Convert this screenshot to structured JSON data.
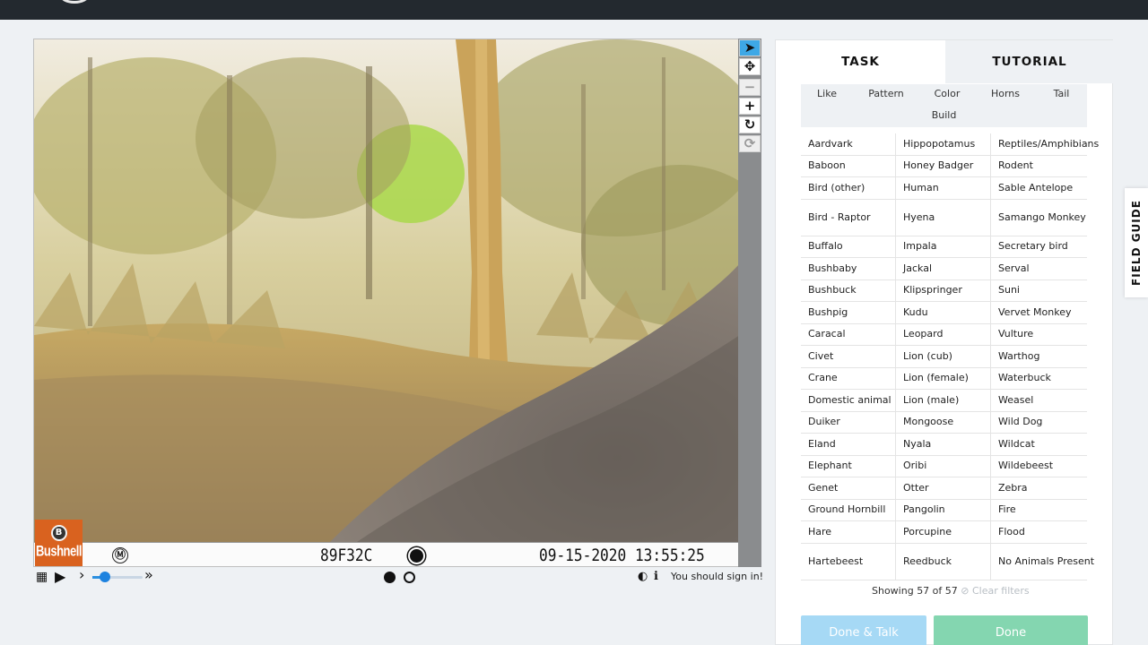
{
  "camera": {
    "brand": "Bushnell",
    "moon_symbol": "Ⓜ",
    "camera_id": "89F32C",
    "timestamp": "09-15-2020 13:55:25"
  },
  "toolbar": {
    "items": [
      {
        "name": "pointer",
        "icon": "pointer-icon",
        "glyph": "➤",
        "state": "active"
      },
      {
        "name": "move",
        "icon": "move-icon",
        "glyph": "✥",
        "state": "normal"
      },
      {
        "name": "zoom-out",
        "icon": "minus-icon",
        "glyph": "−",
        "state": "disabled"
      },
      {
        "name": "zoom-in",
        "icon": "plus-icon",
        "glyph": "+",
        "state": "normal"
      },
      {
        "name": "rotate",
        "icon": "rotate-icon",
        "glyph": "↻",
        "state": "normal"
      },
      {
        "name": "reset",
        "icon": "reset-icon",
        "glyph": "⟳",
        "state": "disabled"
      }
    ]
  },
  "controls": {
    "grid_glyph": "▦",
    "play_glyph": "▶",
    "slow_glyph": "›",
    "fast_glyph": "»",
    "contrast_glyph": "◐",
    "info_glyph": "ℹ",
    "signin_text": "You should sign in!",
    "frames": {
      "current": 1,
      "total": 2
    }
  },
  "panel": {
    "tabs": [
      "TASK",
      "TUTORIAL"
    ],
    "active_tab": "TASK",
    "filters": [
      "Like",
      "Pattern",
      "Color",
      "Horns",
      "Tail",
      "Build"
    ],
    "choices": [
      [
        "Aardvark",
        "Hippopotamus",
        "Reptiles/Amphibians"
      ],
      [
        "Baboon",
        "Honey Badger",
        "Rodent"
      ],
      [
        "Bird (other)",
        "Human",
        "Sable Antelope"
      ],
      [
        "Bird - Raptor",
        "Hyena",
        "Samango Monkey"
      ],
      [
        "Buffalo",
        "Impala",
        "Secretary bird"
      ],
      [
        "Bushbaby",
        "Jackal",
        "Serval"
      ],
      [
        "Bushbuck",
        "Klipspringer",
        "Suni"
      ],
      [
        "Bushpig",
        "Kudu",
        "Vervet Monkey"
      ],
      [
        "Caracal",
        "Leopard",
        "Vulture"
      ],
      [
        "Civet",
        "Lion (cub)",
        "Warthog"
      ],
      [
        "Crane",
        "Lion (female)",
        "Waterbuck"
      ],
      [
        "Domestic animal",
        "Lion (male)",
        "Weasel"
      ],
      [
        "Duiker",
        "Mongoose",
        "Wild Dog"
      ],
      [
        "Eland",
        "Nyala",
        "Wildcat"
      ],
      [
        "Elephant",
        "Oribi",
        "Wildebeest"
      ],
      [
        "Genet",
        "Otter",
        "Zebra"
      ],
      [
        "Ground Hornbill",
        "Pangolin",
        "Fire"
      ],
      [
        "Hare",
        "Porcupine",
        "Flood"
      ],
      [
        "Hartebeest",
        "Reedbuck",
        "No Animals Present"
      ]
    ],
    "showing_text": "Showing 57 of 57",
    "clear_filters": "⊘ Clear filters",
    "done_talk": "Done & Talk",
    "done": "Done"
  },
  "field_guide": "FIELD GUIDE"
}
